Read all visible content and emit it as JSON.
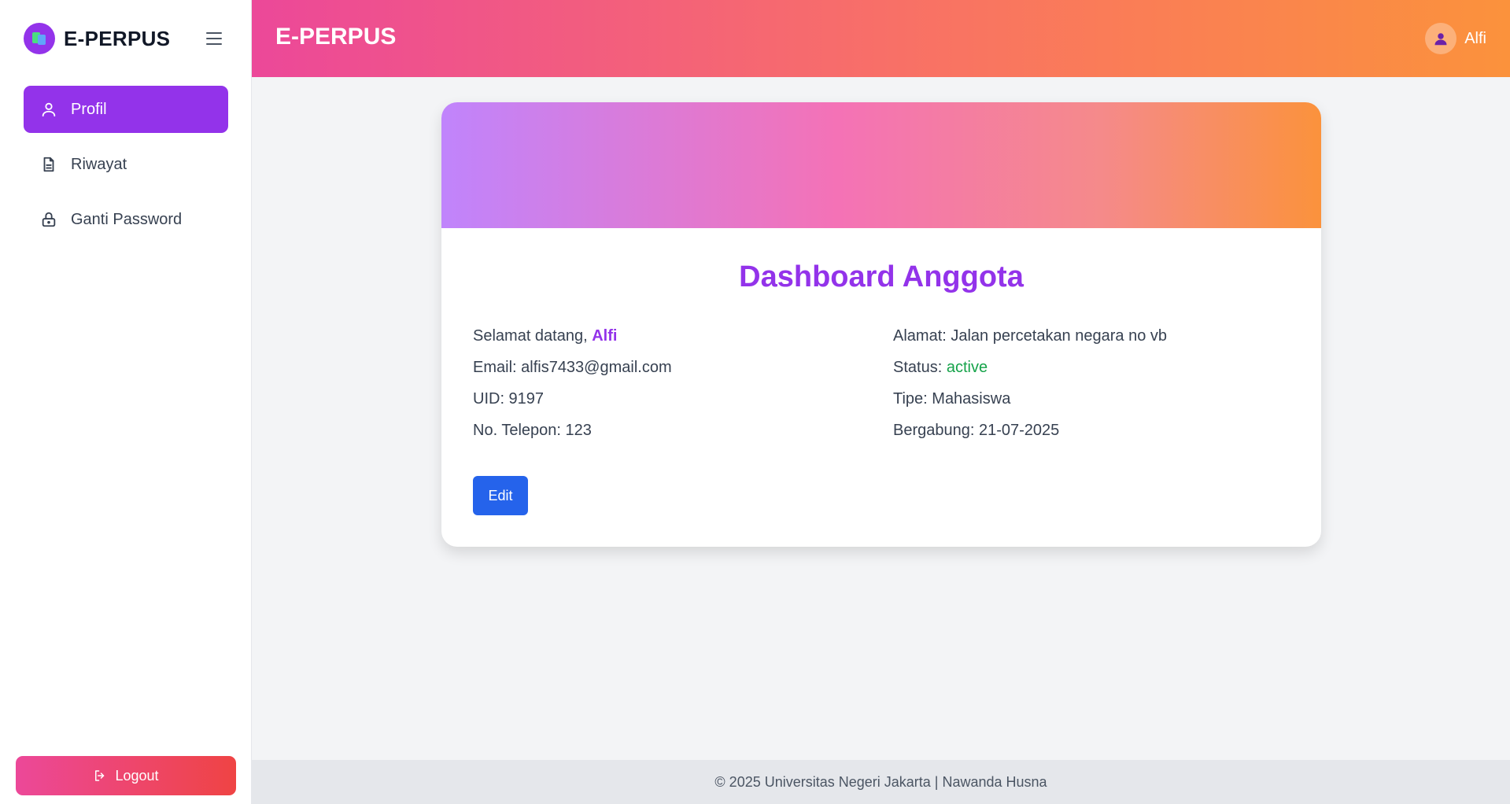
{
  "sidebar": {
    "brand": "E-PERPUS",
    "items": [
      {
        "label": "Profil",
        "icon": "user-icon",
        "active": true
      },
      {
        "label": "Riwayat",
        "icon": "document-icon",
        "active": false
      },
      {
        "label": "Ganti Password",
        "icon": "lock-icon",
        "active": false
      }
    ],
    "logout_label": "Logout"
  },
  "header": {
    "title": "E-PERPUS",
    "user_name": "Alfi"
  },
  "card": {
    "title": "Dashboard Anggota",
    "greeting_prefix": "Selamat datang,",
    "greeting_name": "Alfi",
    "email": "Email: alfis7433@gmail.com",
    "uid": "UID: 9197",
    "phone": "No. Telepon: 123",
    "address": "Alamat: Jalan percetakan negara no vb",
    "status_label": "Status:",
    "status_value": "active",
    "type": "Tipe: Mahasiswa",
    "joined": "Bergabung: 21-07-2025",
    "edit_label": "Edit"
  },
  "footer": {
    "text": "© 2025 Universitas Negeri Jakarta | Nawanda Husna"
  },
  "colors": {
    "accent": "#9333ea",
    "primary_button": "#2563eb",
    "status_active": "#16a34a"
  }
}
